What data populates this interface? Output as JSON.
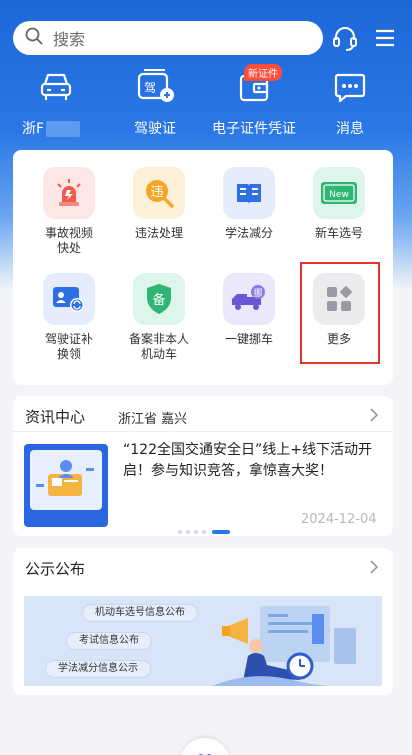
{
  "header": {
    "search_placeholder": "搜索",
    "icons": [
      "search-icon",
      "headset-icon",
      "menu-icon"
    ]
  },
  "top_nav": [
    {
      "label": "浙F",
      "icon": "car-icon"
    },
    {
      "label": "驾驶证",
      "icon": "license-card-icon"
    },
    {
      "label": "电子证件凭证",
      "icon": "wallet-icon",
      "badge": "新证件"
    },
    {
      "label": "消息",
      "icon": "chat-icon"
    }
  ],
  "services": [
    {
      "label": "事故视频快处",
      "icon": "alarm-light-icon"
    },
    {
      "label": "违法处理",
      "icon": "violation-search-icon",
      "glyph": "违"
    },
    {
      "label": "学法减分",
      "icon": "book-icon"
    },
    {
      "label": "新车选号",
      "icon": "new-plate-icon",
      "glyph": "New"
    },
    {
      "label": "驾驶证补换领",
      "icon": "id-card-refresh-icon"
    },
    {
      "label": "备案非本人机动车",
      "icon": "shield-record-icon",
      "glyph": "备"
    },
    {
      "label": "一键挪车",
      "icon": "tow-truck-icon",
      "glyph": "挪"
    },
    {
      "label": "更多",
      "icon": "grid-more-icon"
    }
  ],
  "news": {
    "title": "资讯中心",
    "location": "浙江省 嘉兴",
    "headline": "“122全国交通安全日”线上+线下活动开启！参与知识竞答，拿惊喜大奖！",
    "date": "2024-12-04"
  },
  "notice": {
    "title": "公示公布",
    "pills": [
      "机动车选号信息公布",
      "考试信息公布",
      "学法减分信息公示"
    ]
  },
  "colors": {
    "brand_blue": "#2b77e6",
    "highlight_red": "#e8322b",
    "badge_red": "#ff4d3a"
  }
}
